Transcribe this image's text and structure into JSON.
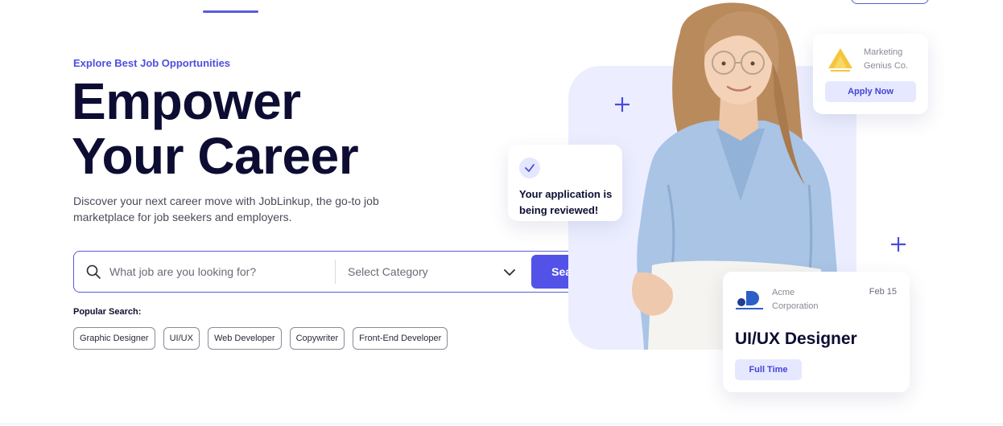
{
  "hero": {
    "eyebrow": "Explore Best Job Opportunities",
    "title_line1": "Empower",
    "title_line2": "Your Career",
    "subtitle": "Discover your next career move with JobLinkup, the go-to job marketplace for job seekers and employers."
  },
  "search": {
    "placeholder": "What job are you looking for?",
    "category_value": "Select Category",
    "button_label": "Search"
  },
  "popular": {
    "label": "Popular Search:",
    "tags": [
      "Graphic Designer",
      "UI/UX",
      "Web Developer",
      "Copywriter",
      "Front-End Developer"
    ]
  },
  "cards": {
    "review": {
      "text": "Your application is being reviewed!"
    },
    "apply": {
      "company": "Marketing Genius Co.",
      "button_label": "Apply Now"
    },
    "job": {
      "company": "Acme Corporation",
      "date": "Feb 15",
      "title": "UI/UX Designer",
      "type": "Full Time"
    }
  },
  "icons": {
    "search": "search-icon",
    "chevron": "chevron-down-icon",
    "check": "check-icon",
    "plus": "plus-icon"
  },
  "colors": {
    "accent": "#5252e8",
    "title": "#0d0d33",
    "soft_accent": "#e6e8ff",
    "hero_bg": "#eceeff"
  }
}
